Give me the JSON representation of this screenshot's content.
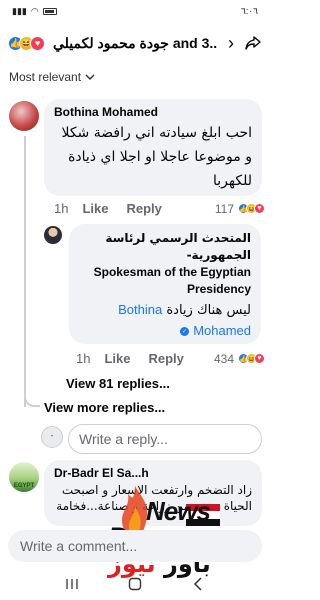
{
  "status_bar": {
    "time": "٦:٠٦"
  },
  "header": {
    "title": "جودة محمود لكميلي and 3...",
    "reactions": [
      {
        "type": "like",
        "glyph": "👍",
        "color": "#1877f2"
      },
      {
        "type": "haha",
        "glyph": "😆",
        "color": "#f7b125"
      },
      {
        "type": "love",
        "glyph": "♥",
        "color": "#f33e58"
      }
    ]
  },
  "sort": {
    "label": "Most relevant"
  },
  "comments": [
    {
      "author": "Bothina Mohamed",
      "text": "احب ابلغ سيادته اني رافضة شكلا و موضوعا عاجلا او اجلا اي ذيادة للكهربا",
      "time": "1h",
      "like_label": "Like",
      "reply_label": "Reply",
      "reaction_count": "117"
    }
  ],
  "reply": {
    "author_ar": "المتحدث الرسمي لرئاسة الجمهورية-",
    "author_en": "Spokesman of the Egyptian Presidency",
    "mention": "Bothina Mohamed",
    "text": "ليس هناك زيادة",
    "time": "1h",
    "like_label": "Like",
    "reply_label": "Reply",
    "reaction_count": "434"
  },
  "view_replies": "View 81 replies...",
  "view_more_replies": "View more replies...",
  "reply_input": {
    "placeholder": "Write a reply..."
  },
  "second_comment": {
    "author": "Dr-Badr El Sa...h",
    "text": "زاد التضخم وارتفعت الاسعار و اصبحت الحياة صعبة من زراعة و صناعة...فخامة",
    "avatar_text": "EGYPT"
  },
  "watermark": {
    "latin_top": "News",
    "latin_bottom": "Power",
    "arabic_dark": "باور",
    "arabic_red": "نيوز"
  },
  "composer": {
    "placeholder": "Write a comment..."
  }
}
